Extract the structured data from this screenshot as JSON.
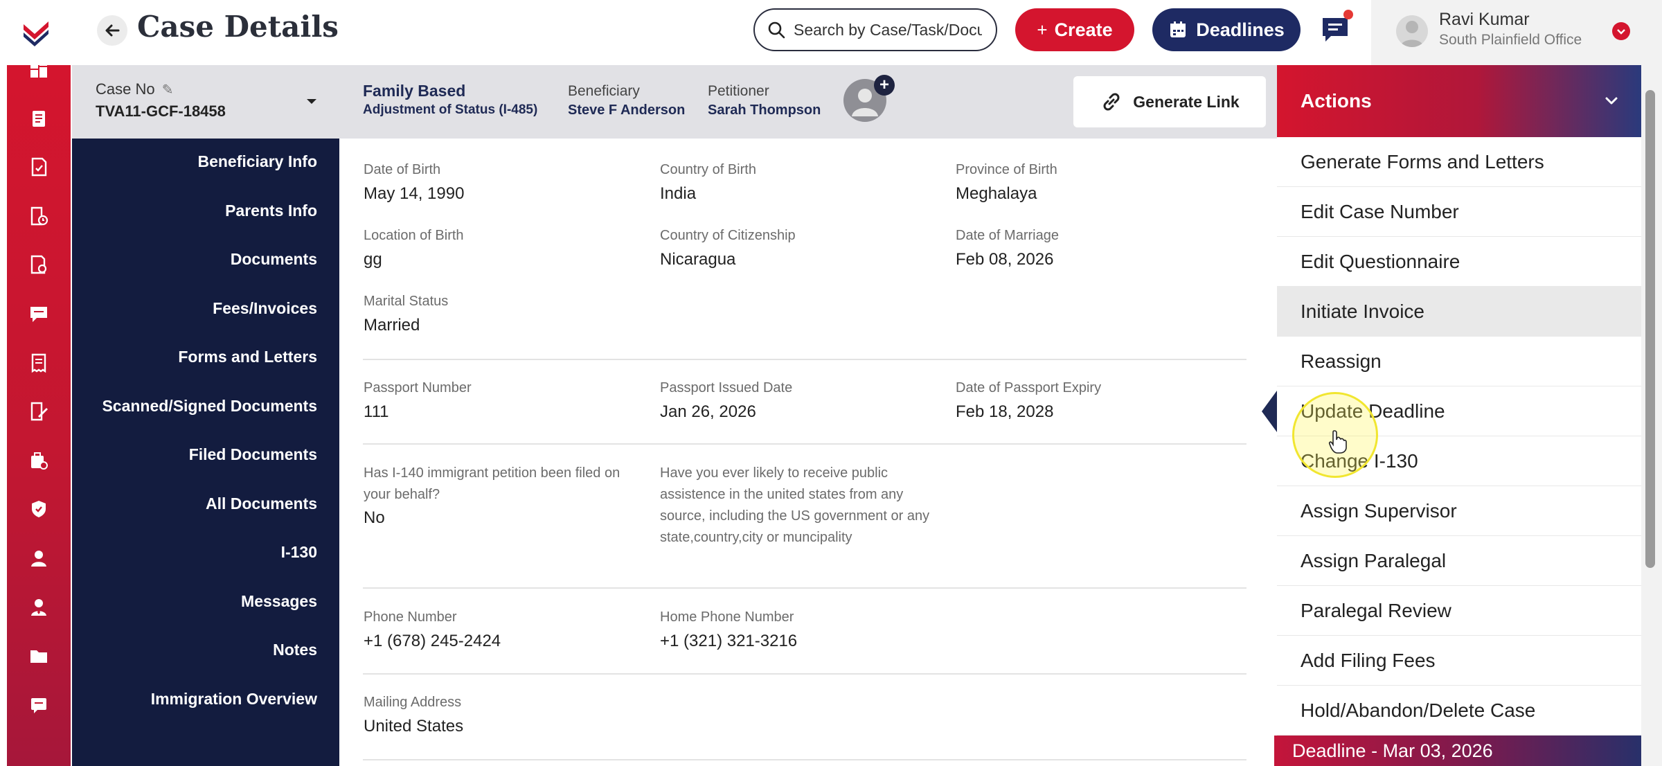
{
  "header": {
    "title": "Case Details",
    "search_placeholder": "Search by Case/Task/Document",
    "create_label": "Create",
    "deadlines_label": "Deadlines"
  },
  "user": {
    "name": "Ravi Kumar",
    "office": "South Plainfield Office"
  },
  "case_bar": {
    "case_no_label": "Case No",
    "case_no": "TVA11-GCF-18458",
    "case_type": "Family Based",
    "case_subtype": "Adjustment of Status (I-485)",
    "beneficiary_label": "Beneficiary",
    "beneficiary": "Steve F Anderson",
    "petitioner_label": "Petitioner",
    "petitioner": "Sarah Thompson",
    "generate_link_label": "Generate Link"
  },
  "section_nav": [
    "Beneficiary Info",
    "Parents Info",
    "Documents",
    "Fees/Invoices",
    "Forms and Letters",
    "Scanned/Signed Documents",
    "Filed Documents",
    "All Documents",
    "I-130",
    "Messages",
    "Notes",
    "Immigration Overview"
  ],
  "fields": {
    "dob_label": "Date of Birth",
    "dob": "May 14, 1990",
    "cob_label": "Country of Birth",
    "cob": "India",
    "pob_label": "Province of Birth",
    "pob": "Meghalaya",
    "lob_label": "Location of Birth",
    "lob": "gg",
    "coc_label": "Country of Citizenship",
    "coc": "Nicaragua",
    "dom_label": "Date of Marriage",
    "dom": "Feb 08, 2026",
    "marital_label": "Marital Status",
    "marital": "Married",
    "passport_label": "Passport Number",
    "passport": "111",
    "passport_issued_label": "Passport Issued Date",
    "passport_issued": "Jan 26, 2026",
    "passport_expiry_label": "Date of Passport Expiry",
    "passport_expiry": "Feb 18, 2028",
    "i140_label": "Has I-140 immigrant petition been filed on your behalf?",
    "i140": "No",
    "assistance_label": "Have you ever likely to receive public assistence in the united states from any source, including the US government or any state,country,city or muncipality",
    "phone_label": "Phone Number",
    "phone": "+1  (678) 245-2424",
    "home_phone_label": "Home Phone Number",
    "home_phone": "+1  (321) 321-3216",
    "mailing_label": "Mailing Address",
    "mailing": "United States"
  },
  "actions": {
    "title": "Actions",
    "items": [
      "Generate Forms and Letters",
      "Edit Case Number",
      "Edit Questionnaire",
      "Initiate Invoice",
      "Reassign",
      "Update Deadline",
      "Change I-130",
      "Assign Supervisor",
      "Assign Paralegal",
      "Paralegal Review",
      "Add Filing Fees",
      "Hold/Abandon/Delete Case"
    ],
    "active_index": 3,
    "deadline": "Deadline - Mar 03, 2026"
  },
  "colors": {
    "brand_red": "#d4152e",
    "navy": "#1e2a63",
    "nav_bg": "#131c3f"
  },
  "icons": {
    "rail": [
      "dashboard-icon",
      "clipboard-icon",
      "document-check-icon",
      "file-clock-icon",
      "document-gear-icon",
      "chat-icon",
      "receipt-icon",
      "edit-document-icon",
      "briefcase-doc-icon",
      "badge-icon",
      "user-icon",
      "user-tie-icon",
      "folder-icon",
      "message-square-icon"
    ]
  }
}
